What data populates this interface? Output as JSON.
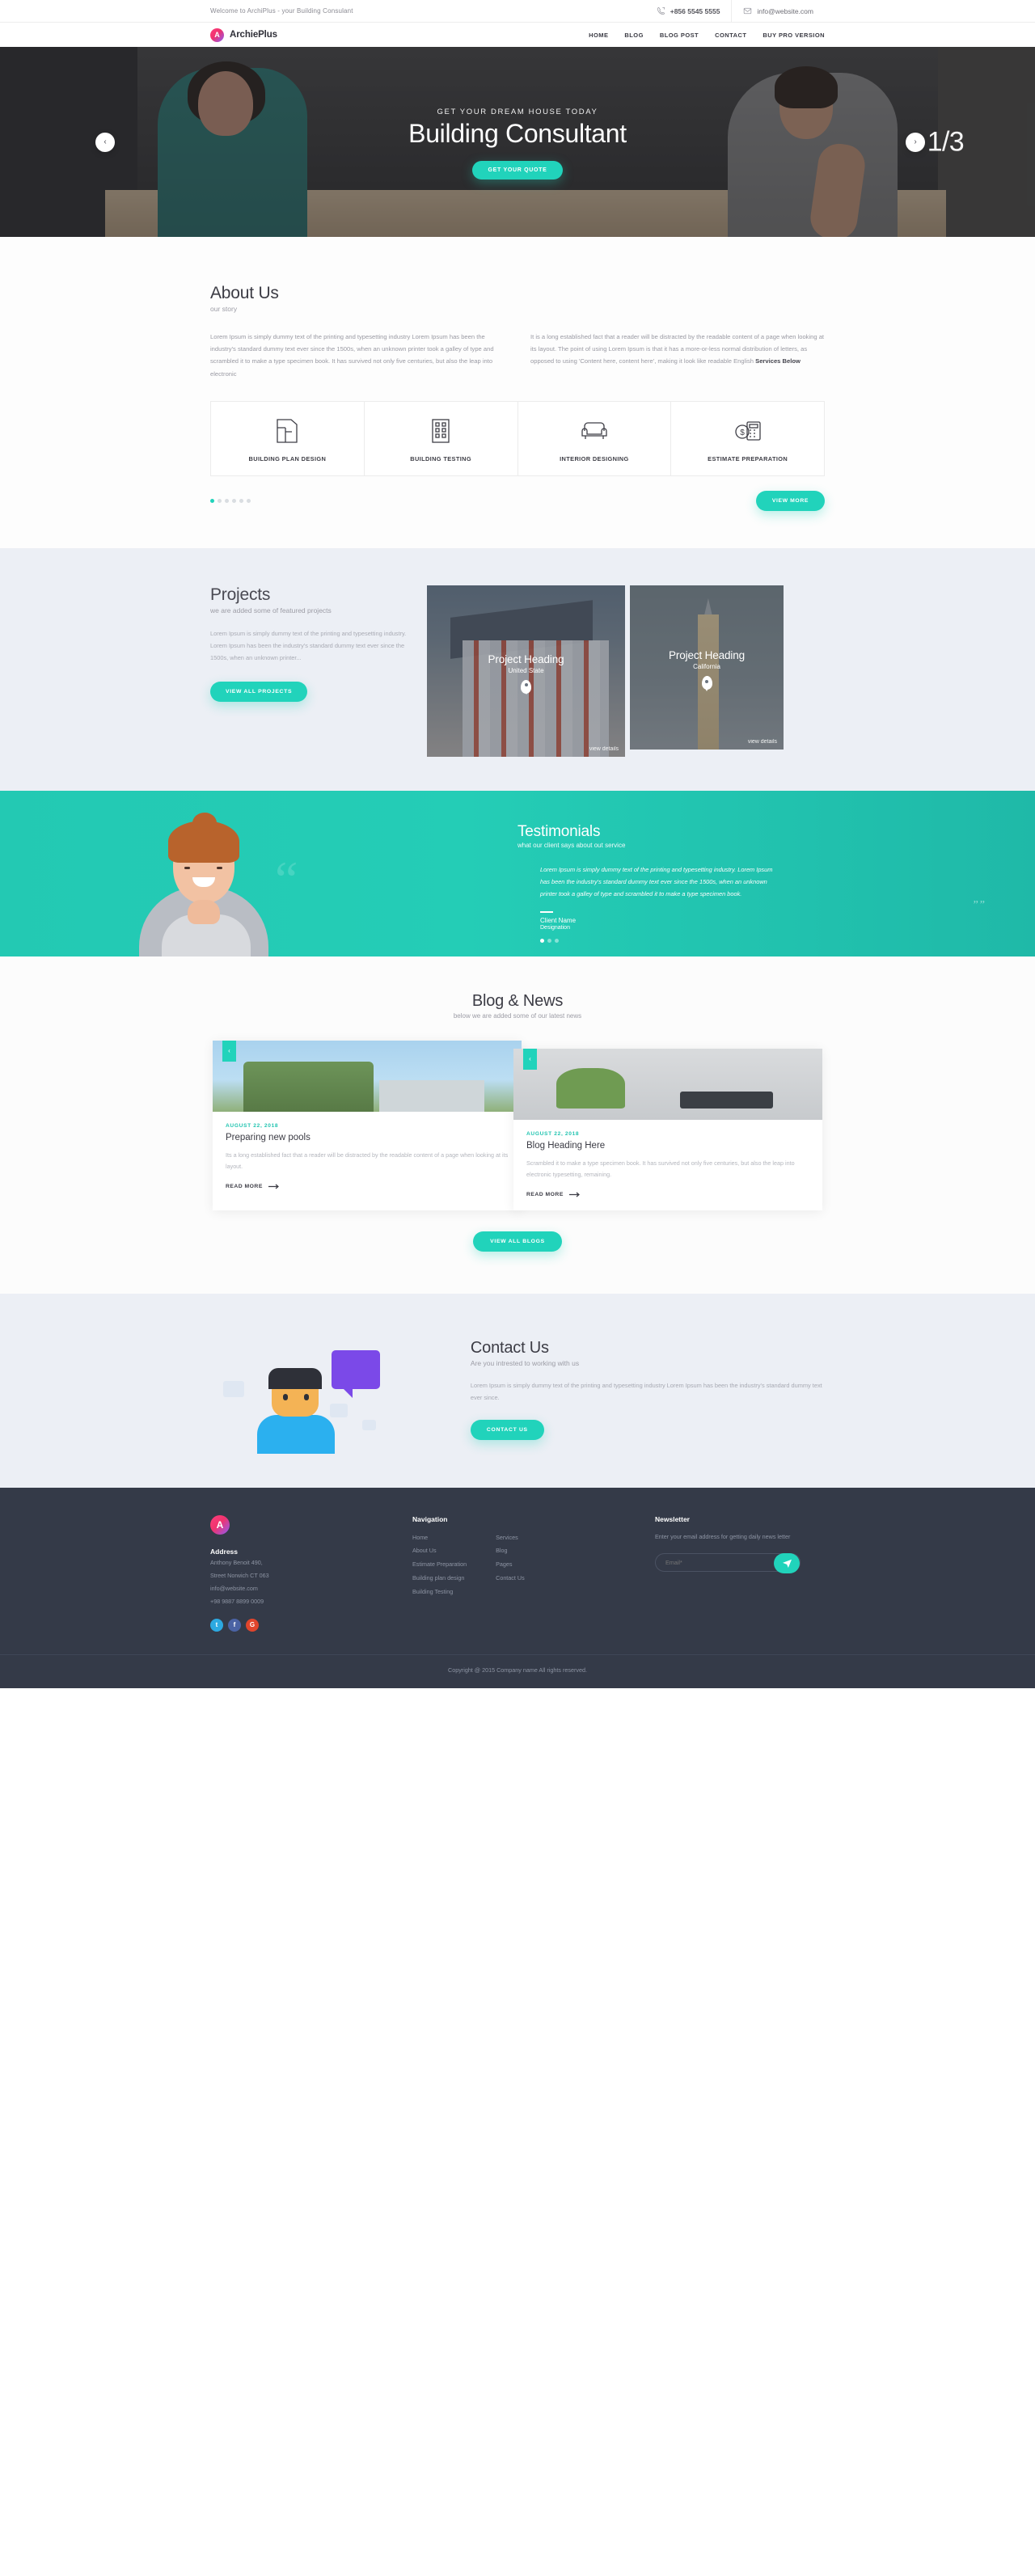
{
  "topbar": {
    "welcome": "Welcome to ArchiPlus - your Building Consulant",
    "phone": "+856 5545 5555",
    "email": "info@website.com"
  },
  "header": {
    "brand": "ArchiePlus",
    "logo_letter": "A",
    "nav": [
      {
        "label": "HOME"
      },
      {
        "label": "BLOG"
      },
      {
        "label": "BLOG POST"
      },
      {
        "label": "CONTACT"
      },
      {
        "label": "BUY PRO VERSION"
      }
    ]
  },
  "hero": {
    "eyebrow": "GET YOUR DREAM HOUSE TODAY",
    "title": "Building Consultant",
    "button": "GET YOUR QUOTE",
    "prev": "‹",
    "next": "›",
    "counter": "1/3"
  },
  "about": {
    "title": "About Us",
    "subtitle": "our story",
    "paragraph_left": "Lorem Ipsum is simply dummy text of the printing and typesetting industry Lorem Ipsum has been the industry's standard dummy text ever since the 1500s, when an unknown printer took a galley of type and scrambled it to make a type specimen book. It has survived not only five centuries, but also the leap into electronic",
    "paragraph_right": "It is a long established fact that a reader will be distracted by the readable content of a page when looking at its layout. The point of using Lorem Ipsum is that it has a more-or-less normal distribution of letters, as opposed to using 'Content here, content here', making it look like readable English ",
    "paragraph_right_bold": "Services Below",
    "services": [
      {
        "label": "BUILDING PLAN DESIGN",
        "icon": "floorplan-icon"
      },
      {
        "label": "BUILDING TESTING",
        "icon": "building-icon"
      },
      {
        "label": "INTERIOR DESIGNING",
        "icon": "sofa-icon"
      },
      {
        "label": "ESTIMATE PREPARATION",
        "icon": "calculator-icon"
      }
    ],
    "dots_count": 6,
    "dots_active": 0,
    "view_more": "VIEW MORE"
  },
  "projects": {
    "title": "Projects",
    "subtitle": "we are added some of featured projects",
    "description": "Lorem Ipsum is simply dummy text of the printing and typesetting industry. Lorem Ipsum has been the industry's standard dummy text ever since the 1500s, when an unknown printer...",
    "button": "VIEW ALL PROJECTS",
    "cards": [
      {
        "title": "Project Heading",
        "location": "United State",
        "link": "view details"
      },
      {
        "title": "Project Heading",
        "location": "California",
        "link": "view details"
      }
    ]
  },
  "testimonials": {
    "title": "Testimonials",
    "subtitle": "what our client says about out service",
    "quote": "Lorem Ipsum is simply dummy text of the printing and typesetting industry. Lorem Ipsum has been the industry's standard dummy text ever since the 1500s, when an unknown printer took a galley of type and scrambled it to make a type specimen book.",
    "client_name": "Client Name",
    "designation": "Designation",
    "dots_count": 3,
    "dots_active": 0
  },
  "blog": {
    "title": "Blog & News",
    "subtitle": "below we are added some of our latest news",
    "view_all": "VIEW ALL BLOGS",
    "posts": [
      {
        "date": "AUGUST 22, 2018",
        "title": "Preparing new pools",
        "excerpt": "Its a long established fact that a reader will be distracted by the readable content of a page when looking at its layout.",
        "read_more": "READ MORE",
        "badge": "‹"
      },
      {
        "date": "AUGUST 22, 2018",
        "title": "Blog Heading Here",
        "excerpt": "Scrambled it to make a type specimen book. It has survived not only five centuries, but also the leap into electronic typesetting, remaining.",
        "read_more": "READ MORE",
        "badge": "‹"
      }
    ]
  },
  "contact": {
    "title": "Contact Us",
    "subtitle": "Are you intrested to working with us",
    "paragraph": "Lorem Ipsum is simply dummy text of the printing and typesetting industry Lorem Ipsum has been the industry's standard dummy text ever since.",
    "button": "CONTACT US"
  },
  "footer": {
    "logo_letter": "A",
    "address_heading": "Address",
    "address_line1": "Anthony Benoit 490,",
    "address_line2": "Street Norwich CT 063",
    "email": "info@website.com",
    "phone": "+98 9887 8899 0009",
    "socials": [
      {
        "name": "twitter",
        "glyph": "t"
      },
      {
        "name": "facebook",
        "glyph": "f"
      },
      {
        "name": "googleplus",
        "glyph": "G"
      }
    ],
    "nav_heading": "Navigation",
    "nav_col1": [
      "Home",
      "About Us",
      "Estimate Preparation",
      "Building plan design",
      "Building Testing"
    ],
    "nav_col2": [
      "Services",
      "Blog",
      "Pages",
      "Contact Us"
    ],
    "newsletter_heading": "Newsletter",
    "newsletter_desc": "Enter your email address for getting daily news letter",
    "newsletter_placeholder": "Email*",
    "newsletter_value": "",
    "copyright": "Copyright @ 2015 Company name All rights reserved."
  },
  "colors": {
    "accent": "#21d3bb",
    "footer_bg": "#343a48",
    "light_bg": "#eceff5"
  }
}
